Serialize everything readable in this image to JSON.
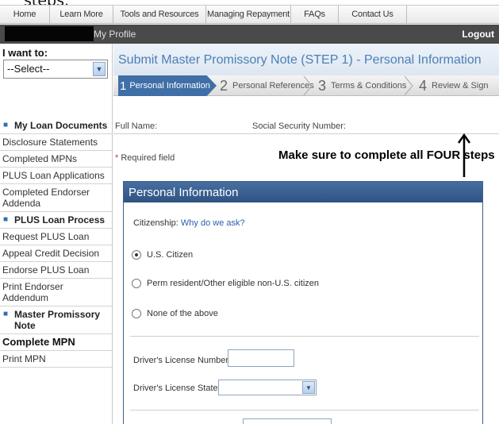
{
  "caption_fragment": "steps.",
  "nav": {
    "tabs": [
      {
        "label": "Home"
      },
      {
        "label": "Learn More"
      },
      {
        "label": "Tools and Resources"
      },
      {
        "label": "Managing Repayment"
      },
      {
        "label": "FAQs"
      },
      {
        "label": "Contact Us"
      },
      {
        "label": ""
      }
    ]
  },
  "header": {
    "my_profile": "My Profile",
    "logout": "Logout"
  },
  "sidebar": {
    "i_want_to": "I want to:",
    "select_value": "--Select--",
    "items": [
      {
        "label": "My Loan Documents",
        "type": "heading"
      },
      {
        "label": "Disclosure Statements",
        "type": "link"
      },
      {
        "label": "Completed MPNs",
        "type": "link"
      },
      {
        "label": "PLUS Loan Applications",
        "type": "link"
      },
      {
        "label": "Completed Endorser Addenda",
        "type": "link"
      },
      {
        "label": "PLUS Loan Process",
        "type": "heading"
      },
      {
        "label": "Request PLUS Loan",
        "type": "link"
      },
      {
        "label": "Appeal Credit Decision",
        "type": "link"
      },
      {
        "label": "Endorse PLUS Loan",
        "type": "link"
      },
      {
        "label": "Print Endorser Addendum",
        "type": "link"
      },
      {
        "label": "Master Promissory Note",
        "type": "heading"
      },
      {
        "label": "Complete MPN",
        "type": "current"
      },
      {
        "label": "Print MPN",
        "type": "link"
      }
    ]
  },
  "main": {
    "title": "Submit Master Promissory Note (STEP 1) - Personal Information",
    "steps": [
      {
        "num": "1",
        "label": "Personal Information"
      },
      {
        "num": "2",
        "label": "Personal References"
      },
      {
        "num": "3",
        "label": "Terms & Conditions"
      },
      {
        "num": "4",
        "label": "Review & Sign"
      }
    ],
    "full_name_label": "Full Name:",
    "ssn_label": "Social Security Number:",
    "required_star": "*",
    "required_text": "Required field",
    "annotation": "Make sure to complete all FOUR steps",
    "panel": {
      "title": "Personal Information",
      "citizenship_label": "Citizenship:",
      "why_link": "Why do we ask?",
      "options": [
        {
          "label": "U.S. Citizen",
          "selected": true
        },
        {
          "label": "Perm resident/Other eligible non-U.S. citizen",
          "selected": false
        },
        {
          "label": "None of the above",
          "selected": false
        }
      ],
      "license_number_label": "Driver's License Number:",
      "license_number_value": "",
      "license_state_label": "Driver's License State:",
      "license_state_value": ""
    }
  },
  "colors": {
    "accent_blue": "#3f6fa6",
    "header_dark": "#4a4a4a",
    "link_blue": "#2b5fb0",
    "title_blue": "#4a7fb6"
  }
}
